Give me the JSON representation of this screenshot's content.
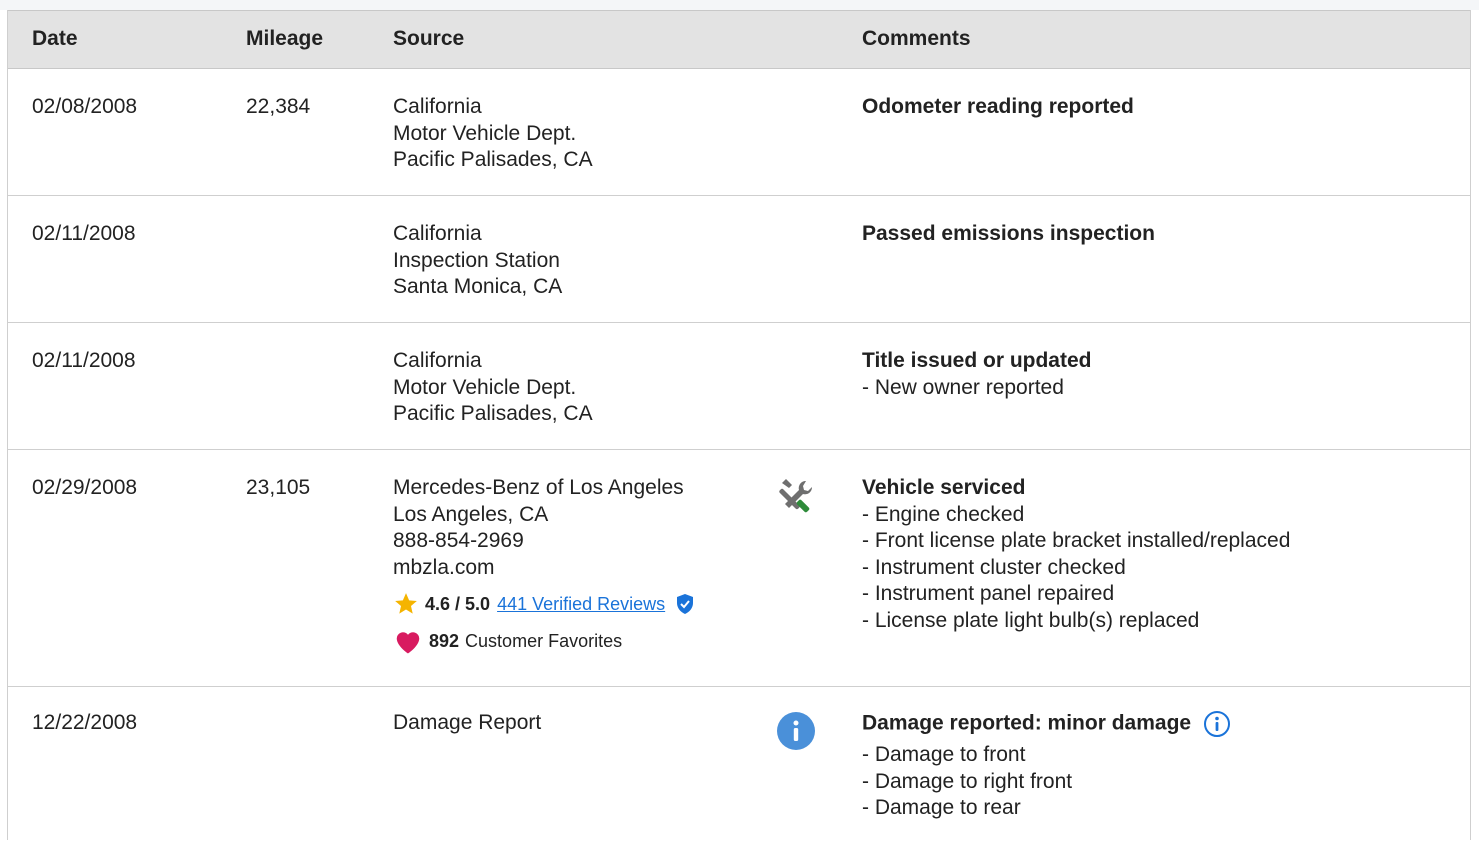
{
  "headers": {
    "date": "Date",
    "mileage": "Mileage",
    "source": "Source",
    "comments": "Comments"
  },
  "rows": [
    {
      "date": "02/08/2008",
      "mileage": "22,384",
      "source": [
        "California",
        "Motor Vehicle Dept.",
        "Pacific Palisades, CA"
      ],
      "comment_title": "Odometer reading reported",
      "comment_items": []
    },
    {
      "date": "02/11/2008",
      "mileage": "",
      "source": [
        "California",
        "Inspection Station",
        "Santa Monica, CA"
      ],
      "comment_title": "Passed emissions inspection",
      "comment_items": []
    },
    {
      "date": "02/11/2008",
      "mileage": "",
      "source": [
        "California",
        "Motor Vehicle Dept.",
        "Pacific Palisades, CA"
      ],
      "comment_title": "Title issued or updated",
      "comment_items": [
        "- New owner reported"
      ]
    },
    {
      "date": "02/29/2008",
      "mileage": "23,105",
      "source": [
        "Mercedes-Benz of Los Angeles",
        "Los Angeles, CA",
        "888-854-2969",
        "mbzla.com"
      ],
      "rating": "4.6 / 5.0",
      "reviews_link": "441 Verified Reviews",
      "favorites_count": "892",
      "favorites_label": "Customer Favorites",
      "icon": "service-tools-icon",
      "comment_title": "Vehicle serviced",
      "comment_items": [
        "- Engine checked",
        "- Front license plate bracket installed/replaced",
        "- Instrument cluster checked",
        "- Instrument panel repaired",
        "- License plate light bulb(s) replaced"
      ]
    },
    {
      "date": "12/22/2008",
      "mileage": "",
      "source": [
        "Damage Report"
      ],
      "icon": "info-icon",
      "comment_title": "Damage reported: minor damage",
      "comment_items": [
        "- Damage to front",
        "- Damage to right front",
        "- Damage to rear"
      ]
    }
  ],
  "colors": {
    "header_bg": "#e3e3e3",
    "link": "#1a73d9",
    "star": "#f5b400",
    "heart": "#d81b60",
    "info_blue": "#4a90d9",
    "tool_green": "#2e8b3a",
    "tool_gray": "#6f6f6f"
  }
}
